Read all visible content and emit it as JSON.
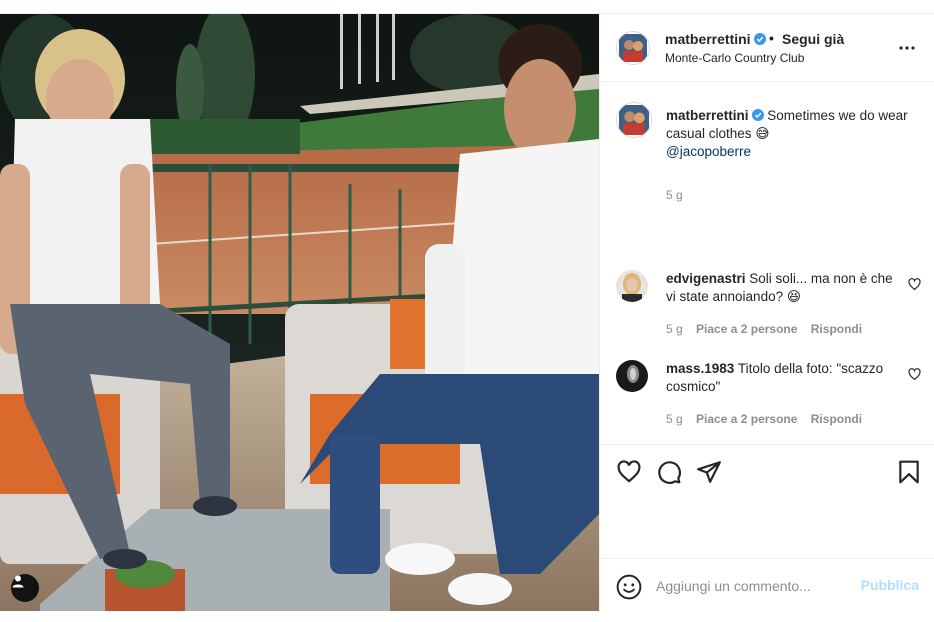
{
  "colors": {
    "text": "#262626",
    "muted": "#8e8e8e",
    "mention": "#00376b",
    "verified": "#3897f0",
    "publish_disabled": "#b2dffc",
    "border": "#efefef"
  },
  "photo": {
    "alt_icon": "user-tag-icon"
  },
  "header": {
    "username": "matberrettini",
    "verified_icon": "verified-badge-icon",
    "separator": "•",
    "follow_label": "Segui già",
    "location": "Monte-Carlo Country Club",
    "more_icon": "more-options-icon"
  },
  "caption": {
    "username": "matberrettini",
    "text": "Sometimes we do wear casual clothes",
    "emoji": "😅",
    "mention": "@jacopoberre",
    "time": "5 g"
  },
  "comments": [
    {
      "username": "edvigenastri",
      "text": "Soli soli... ma non è che vi state annoiando?",
      "emoji": "😆",
      "time": "5 g",
      "likes": "Piace a 2 persone",
      "reply": "Rispondi"
    },
    {
      "username": "mass.1983",
      "text": "Titolo della foto: \"scazzo cosmico\"",
      "emoji": "",
      "time": "5 g",
      "likes": "Piace a 2 persone",
      "reply": "Rispondi"
    }
  ],
  "actions": {
    "like_icon": "heart-icon",
    "comment_icon": "comment-icon",
    "share_icon": "share-icon",
    "save_icon": "bookmark-icon"
  },
  "add_comment": {
    "emoji_icon": "emoji-icon",
    "placeholder": "Aggiungi un commento...",
    "publish_label": "Pubblica"
  }
}
